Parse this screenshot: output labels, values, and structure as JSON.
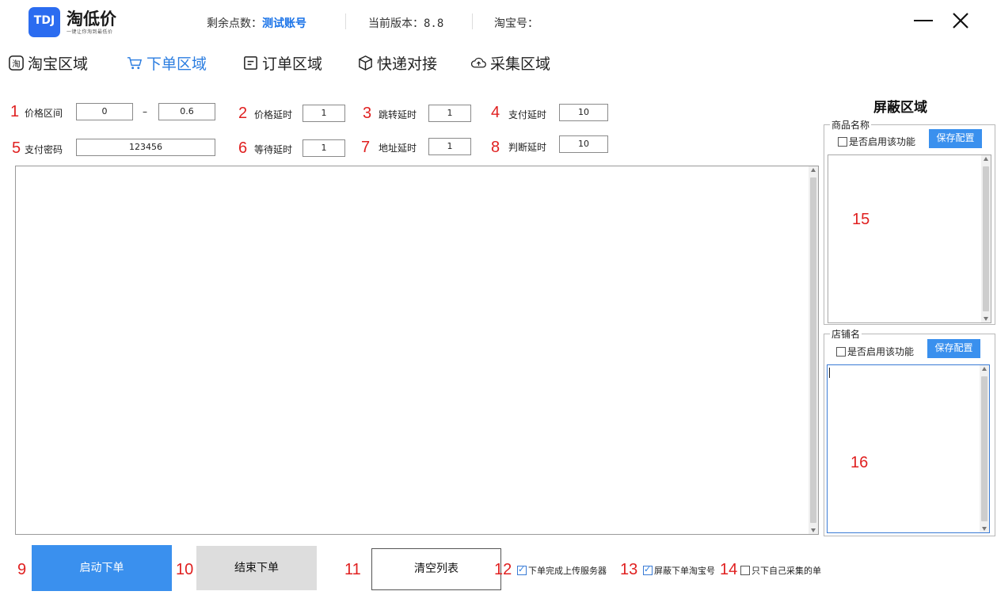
{
  "app": {
    "logo_mark": "TDJ",
    "logo_title": "淘低价",
    "logo_slogan": "一键让你淘到最低价"
  },
  "header": {
    "points_label": "剩余点数：",
    "points_value": "测试账号",
    "version_label": "当前版本：",
    "version_value": "8.8",
    "taobao_label": "淘宝号："
  },
  "window_controls": {
    "minimize_icon": "minimize-icon",
    "close_icon": "close-icon"
  },
  "nav": {
    "items": [
      {
        "label": "淘宝区域",
        "icon": "taobao-icon"
      },
      {
        "label": "下单区域",
        "icon": "cart-icon",
        "active": true
      },
      {
        "label": "订单区域",
        "icon": "order-icon"
      },
      {
        "label": "快递对接",
        "icon": "box-icon"
      },
      {
        "label": "采集区域",
        "icon": "cloud-icon"
      }
    ]
  },
  "form": {
    "price_range_label": "价格区间",
    "price_min": "0",
    "range_sep": "–",
    "price_max": "0.6",
    "price_delay_label": "价格延时",
    "price_delay": "1",
    "jump_delay_label": "跳转延时",
    "jump_delay": "1",
    "pay_delay_label": "支付延时",
    "pay_delay": "10",
    "pay_password_label": "支付密码",
    "pay_password": "123456",
    "wait_delay_label": "等待延时",
    "wait_delay": "1",
    "address_delay_label": "地址延时",
    "address_delay": "1",
    "judge_delay_label": "判断延时",
    "judge_delay": "10"
  },
  "markers": [
    "1",
    "2",
    "3",
    "4",
    "5",
    "6",
    "7",
    "8",
    "9",
    "10",
    "11",
    "12",
    "13",
    "14",
    "15",
    "16"
  ],
  "shield": {
    "title": "屏蔽区域",
    "product_group_title": "商品名称",
    "shop_group_title": "店铺名",
    "enable_label": "是否启用该功能",
    "save_label": "保存配置"
  },
  "bottom": {
    "start_label": "启动下单",
    "stop_label": "结束下单",
    "clear_label": "清空列表",
    "upload_label": "下单完成上传服务器",
    "upload_checked": true,
    "block_tb_label": "屏蔽下单淘宝号",
    "block_tb_checked": true,
    "only_self_label": "只下自己采集的单",
    "only_self_checked": false
  },
  "colors": {
    "accent": "#2b7de0",
    "primary_button": "#3a90ee",
    "stop_button": "#dddddd",
    "marker_red": "#e02020"
  }
}
